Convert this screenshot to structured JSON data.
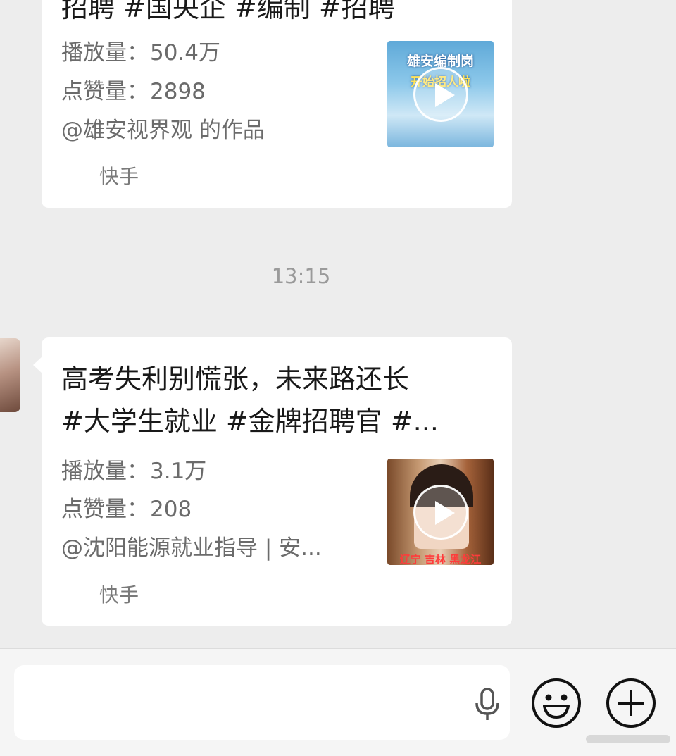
{
  "cards": [
    {
      "title_lines": [
        "招聘 #国央企 #编制 #招聘"
      ],
      "plays_label": "播放量：",
      "plays_value": "50.4万",
      "likes_label": "点赞量：",
      "likes_value": "2898",
      "author": "@雄安视界观 的作品",
      "source": "快手",
      "thumbnail_text": [
        "雄安编制岗",
        "开始招人啦"
      ]
    },
    {
      "title_lines": [
        "高考失利别慌张，未来路还长",
        "#大学生就业 #金牌招聘官 #..."
      ],
      "plays_label": "播放量：",
      "plays_value": "3.1万",
      "likes_label": "点赞量：",
      "likes_value": "208",
      "author": "@沈阳能源就业指导 | 安...",
      "source": "快手",
      "thumbnail_text": [
        "辽宁 吉林 黑龙江"
      ]
    }
  ],
  "timestamp": "13:15",
  "composer": {
    "placeholder": "",
    "icons": [
      "microphone-icon",
      "emoji-icon",
      "plus-icon"
    ]
  },
  "colors": {
    "background": "#ededed",
    "card": "#ffffff",
    "meta_text": "#6b6b6b",
    "timestamp": "#9a9a9a"
  }
}
